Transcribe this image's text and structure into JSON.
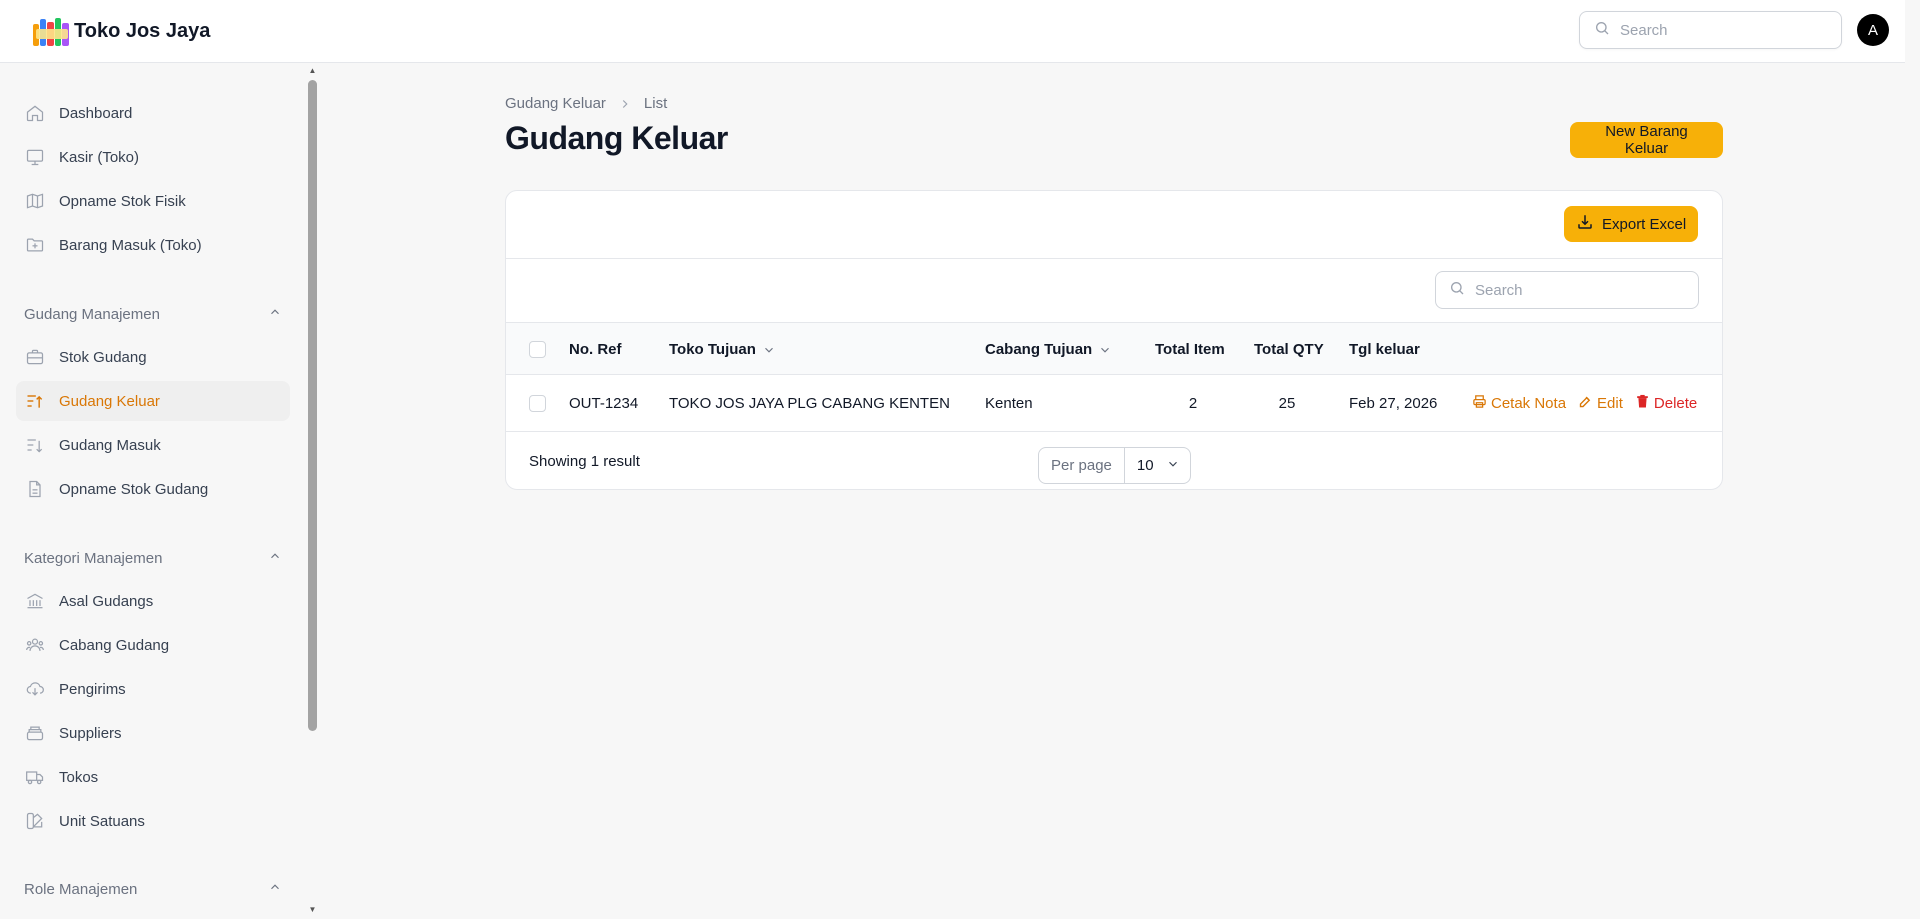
{
  "app": {
    "name": "Toko Jos Jaya",
    "logo_icon": "plastic-jos-jaya-logo"
  },
  "topbar": {
    "search_placeholder": "Search",
    "avatar_initial": "A"
  },
  "sidebar": {
    "top_items": [
      {
        "label": "Dashboard",
        "icon": "home-icon"
      },
      {
        "label": "Kasir (Toko)",
        "icon": "monitor-icon"
      },
      {
        "label": "Opname Stok Fisik",
        "icon": "map-icon"
      },
      {
        "label": "Barang Masuk (Toko)",
        "icon": "folder-plus-icon"
      }
    ],
    "groups": [
      {
        "label": "Gudang Manajemen",
        "items": [
          {
            "label": "Stok Gudang",
            "icon": "briefcase-icon"
          },
          {
            "label": "Gudang Keluar",
            "icon": "sort-up-icon",
            "active": true
          },
          {
            "label": "Gudang Masuk",
            "icon": "sort-down-icon"
          },
          {
            "label": "Opname Stok Gudang",
            "icon": "document-icon"
          }
        ]
      },
      {
        "label": "Kategori Manajemen",
        "items": [
          {
            "label": "Asal Gudangs",
            "icon": "bank-icon"
          },
          {
            "label": "Cabang Gudang",
            "icon": "users-icon"
          },
          {
            "label": "Pengirims",
            "icon": "cloud-download-icon"
          },
          {
            "label": "Suppliers",
            "icon": "stack-icon"
          },
          {
            "label": "Tokos",
            "icon": "truck-icon"
          },
          {
            "label": "Unit Satuans",
            "icon": "swatch-icon"
          }
        ]
      },
      {
        "label": "Role Manajemen",
        "items": []
      }
    ]
  },
  "page": {
    "breadcrumb": [
      "Gudang Keluar",
      "List"
    ],
    "title": "Gudang Keluar",
    "new_button": "New Barang Keluar"
  },
  "table": {
    "export_label": "Export Excel",
    "search_placeholder": "Search",
    "columns": [
      "No. Ref",
      "Toko Tujuan",
      "Cabang Tujuan",
      "Total Item",
      "Total QTY",
      "Tgl keluar"
    ],
    "rows": [
      {
        "no_ref": "OUT-1234",
        "toko_tujuan": "TOKO JOS JAYA PLG CABANG KENTEN",
        "cabang_tujuan": "Kenten",
        "total_item": "2",
        "total_qty": "25",
        "tgl_keluar": "Feb 27, 2026",
        "actions": [
          "Cetak Nota",
          "Edit",
          "Delete"
        ]
      }
    ],
    "result_text": "Showing 1 result",
    "per_page_label": "Per page",
    "per_page_value": "10"
  },
  "colors": {
    "accent": "#f7b008",
    "active": "#d97706",
    "danger": "#dc2626"
  }
}
